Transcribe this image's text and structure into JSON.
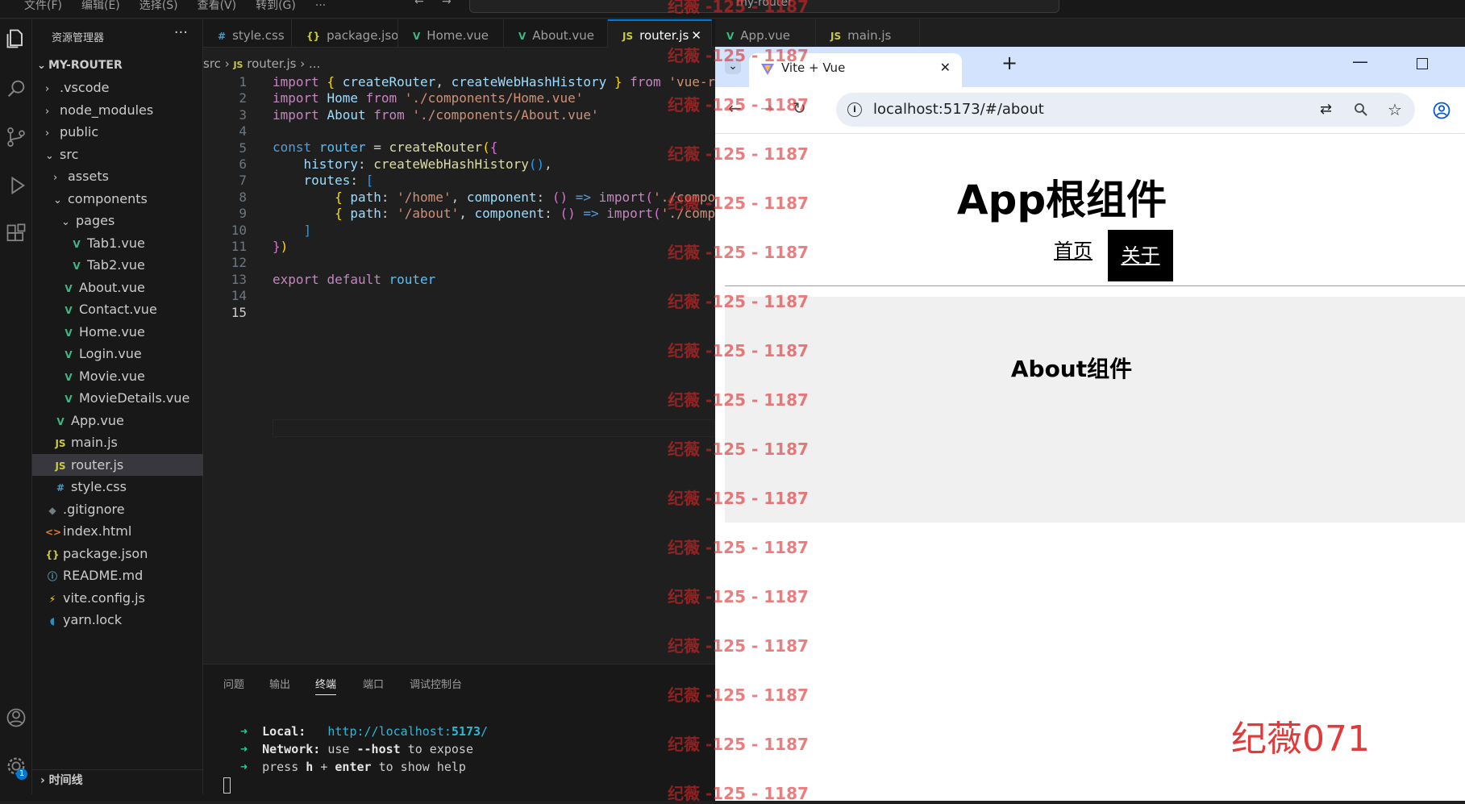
{
  "titlebar": {
    "menus": [
      "文件(F)",
      "编辑(E)",
      "选择(S)",
      "查看(V)",
      "转到(G)",
      "···"
    ],
    "command_center": "my-router"
  },
  "sidebar": {
    "title": "资源管理器",
    "more": "···",
    "project": "MY-ROUTER",
    "items": [
      {
        "label": ".vscode",
        "type": "folder",
        "expanded": false,
        "indent": 1
      },
      {
        "label": "node_modules",
        "type": "folder",
        "expanded": false,
        "indent": 1
      },
      {
        "label": "public",
        "type": "folder",
        "expanded": false,
        "indent": 1
      },
      {
        "label": "src",
        "type": "folder",
        "expanded": true,
        "indent": 1
      },
      {
        "label": "assets",
        "type": "folder",
        "expanded": false,
        "indent": 2
      },
      {
        "label": "components",
        "type": "folder",
        "expanded": true,
        "indent": 2
      },
      {
        "label": "pages",
        "type": "folder",
        "expanded": true,
        "indent": 3
      },
      {
        "label": "Tab1.vue",
        "type": "vue",
        "indent": 4
      },
      {
        "label": "Tab2.vue",
        "type": "vue",
        "indent": 4
      },
      {
        "label": "About.vue",
        "type": "vue",
        "indent": 3
      },
      {
        "label": "Contact.vue",
        "type": "vue",
        "indent": 3
      },
      {
        "label": "Home.vue",
        "type": "vue",
        "indent": 3
      },
      {
        "label": "Login.vue",
        "type": "vue",
        "indent": 3
      },
      {
        "label": "Movie.vue",
        "type": "vue",
        "indent": 3
      },
      {
        "label": "MovieDetails.vue",
        "type": "vue",
        "indent": 3
      },
      {
        "label": "App.vue",
        "type": "vue",
        "indent": 2
      },
      {
        "label": "main.js",
        "type": "js",
        "indent": 2
      },
      {
        "label": "router.js",
        "type": "js",
        "indent": 2,
        "selected": true
      },
      {
        "label": "style.css",
        "type": "css",
        "indent": 2
      },
      {
        "label": ".gitignore",
        "type": "git",
        "indent": 1
      },
      {
        "label": "index.html",
        "type": "html",
        "indent": 1
      },
      {
        "label": "package.json",
        "type": "json",
        "indent": 1
      },
      {
        "label": "README.md",
        "type": "info",
        "indent": 1
      },
      {
        "label": "vite.config.js",
        "type": "vite",
        "indent": 1
      },
      {
        "label": "yarn.lock",
        "type": "yarn",
        "indent": 1
      }
    ],
    "timeline": "时间线"
  },
  "tabs": [
    {
      "label": "style.css",
      "icon": "#",
      "type": "css"
    },
    {
      "label": "package.json",
      "icon": "{}",
      "type": "json"
    },
    {
      "label": "Home.vue",
      "icon": "V",
      "type": "vue"
    },
    {
      "label": "About.vue",
      "icon": "V",
      "type": "vue"
    },
    {
      "label": "router.js",
      "icon": "JS",
      "type": "js",
      "active": true
    },
    {
      "label": "App.vue",
      "icon": "V",
      "type": "vue"
    },
    {
      "label": "main.js",
      "icon": "JS",
      "type": "js"
    }
  ],
  "breadcrumb": {
    "folder": "src",
    "file": "router.js",
    "more": "..."
  },
  "editor": {
    "current_line": 15,
    "line_numbers": [
      "1",
      "2",
      "3",
      "4",
      "5",
      "6",
      "7",
      "8",
      "9",
      "10",
      "11",
      "12",
      "13",
      "14",
      "15"
    ]
  },
  "panel": {
    "tabs": [
      "问题",
      "输出",
      "终端",
      "端口",
      "调试控制台"
    ],
    "active_tab": "终端",
    "terminal": {
      "local_label": "Local:",
      "local_url": "http://localhost:",
      "local_port": "5173",
      "local_tail": "/",
      "network_label": "Network:",
      "network_text_1": "use",
      "network_flag": "--host",
      "network_text_2": "to expose",
      "help_text_1": "press",
      "help_key": "h",
      "help_plus": "+",
      "help_enter": "enter",
      "help_text_2": "to show help"
    }
  },
  "browser": {
    "tab_title": "Vite + Vue",
    "url": "localhost:5173/#/about",
    "page": {
      "title": "App根组件",
      "nav_home": "首页",
      "nav_about": "关于",
      "content_title": "About组件"
    }
  },
  "watermark": {
    "text": "纪薇 -125 - 1187",
    "signature": "纪薇071"
  },
  "colors": {
    "editor_bg": "#1f1f1f",
    "accent": "#0078d4",
    "vue_green": "#41b883",
    "watermark_red": "#e03a3a"
  }
}
